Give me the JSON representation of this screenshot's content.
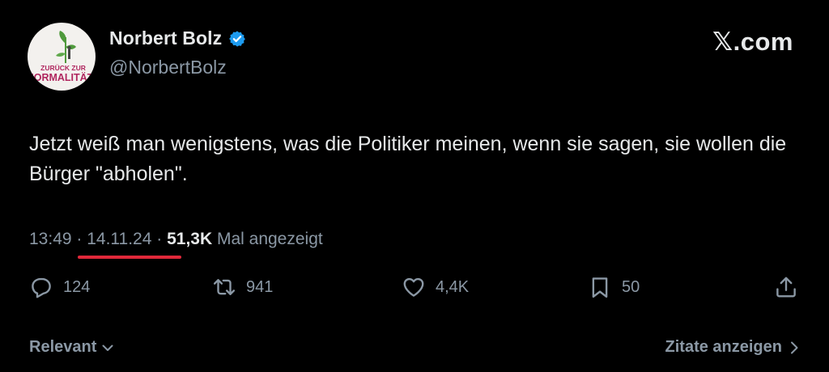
{
  "author": {
    "display_name": "Norbert Bolz",
    "handle": "@NorbertBolz",
    "verified": true,
    "avatar": {
      "line1": "ZURÜCK ZUR",
      "line2": "NORMALITÄT",
      "icon": "seedling-icon"
    }
  },
  "site_mark": {
    "x": "𝕏",
    "rest": ".com"
  },
  "tweet": {
    "text": "Jetzt weiß man wenigstens, was die Politiker meinen, wenn sie sagen, sie wollen die Bürger \"abholen\"."
  },
  "meta": {
    "time": "13:49",
    "sep1": " · ",
    "date": "14.11.24",
    "sep2": " · ",
    "views": "51,3K",
    "views_label": " Mal angezeigt"
  },
  "actions": {
    "reply": {
      "icon": "reply-icon",
      "count": "124"
    },
    "repost": {
      "icon": "repost-icon",
      "count": "941"
    },
    "like": {
      "icon": "heart-icon",
      "count": "4,4K"
    },
    "bookmark": {
      "icon": "bookmark-icon",
      "count": "50"
    },
    "share": {
      "icon": "share-icon"
    }
  },
  "footer": {
    "sort_label": "Relevant",
    "quotes_label": "Zitate anzeigen"
  },
  "colors": {
    "background": "#000000",
    "text": "#e7e9ea",
    "muted": "#8b98a5",
    "verified": "#1d9bf0",
    "highlight_underline": "#e0283a",
    "avatar_text": "#b0275f",
    "avatar_plant": "#4f9a3c"
  }
}
